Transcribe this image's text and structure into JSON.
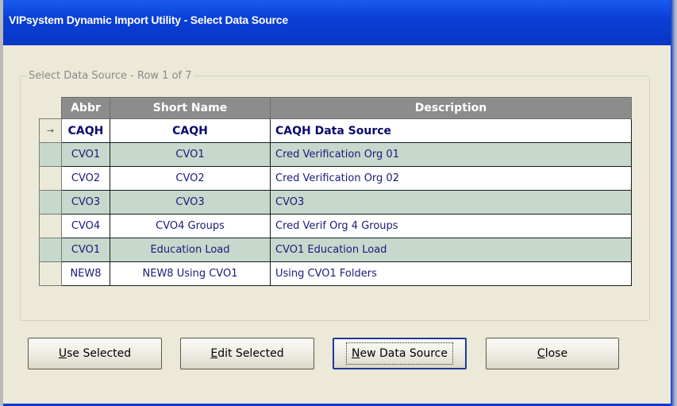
{
  "window": {
    "title": "VIPsystem Dynamic Import Utility - Select Data Source"
  },
  "group": {
    "legend": "Select Data Source - Row 1 of 7"
  },
  "table": {
    "columns": [
      "Abbr",
      "Short Name",
      "Description"
    ],
    "rows": [
      {
        "abbr": "CAQH",
        "short_name": "CAQH",
        "description": "CAQH Data Source",
        "indicator": "→"
      },
      {
        "abbr": "CVO1",
        "short_name": "CVO1",
        "description": "Cred Verification Org 01",
        "indicator": ""
      },
      {
        "abbr": "CVO2",
        "short_name": "CVO2",
        "description": "Cred Verification Org 02",
        "indicator": ""
      },
      {
        "abbr": "CVO3",
        "short_name": "CVO3",
        "description": "CVO3",
        "indicator": ""
      },
      {
        "abbr": "CVO4",
        "short_name": "CVO4 Groups",
        "description": "Cred Verif Org 4 Groups",
        "indicator": ""
      },
      {
        "abbr": "CVO1",
        "short_name": "Education Load",
        "description": "CVO1 Education Load",
        "indicator": ""
      },
      {
        "abbr": "NEW8",
        "short_name": "NEW8 Using CVO1",
        "description": "Using CVO1 Folders",
        "indicator": ""
      }
    ]
  },
  "buttons": {
    "use_selected": {
      "mnemonic": "U",
      "rest": "se Selected"
    },
    "edit_selected": {
      "mnemonic": "E",
      "rest": "dit Selected"
    },
    "new_data_source": {
      "mnemonic": "N",
      "rest": "ew Data Source"
    },
    "close": {
      "mnemonic": "C",
      "rest": "lose"
    }
  },
  "colors": {
    "titlebar": "#0a3fd6",
    "row_alt": "#c6d9cc",
    "header": "#8c8c8c"
  }
}
